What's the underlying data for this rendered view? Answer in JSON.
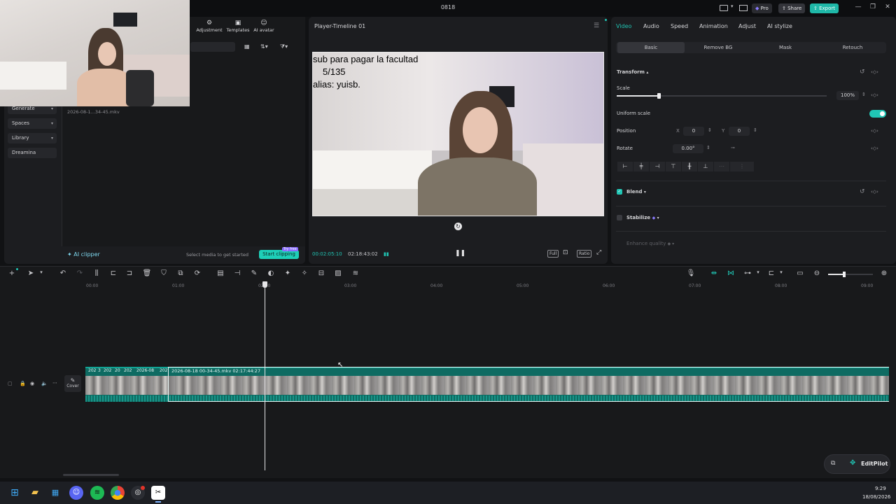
{
  "window": {
    "title": "0818",
    "pro_label": "Pro",
    "share_label": "Share",
    "export_label": "Export"
  },
  "media_toolbar": {
    "adjustment": "Adjustment",
    "templates": "Templates",
    "ai_avatar": "AI avatar"
  },
  "left_nav": {
    "items": [
      "Generate",
      "Spaces",
      "Library",
      "Dreamina"
    ]
  },
  "media": {
    "file_name": "2026-08-1...34-45.mkv",
    "ai_clipper": "AI clipper",
    "hint": "Select media to get started",
    "start_clipping": "Start clipping",
    "try_free": "Try free"
  },
  "player": {
    "title": "Player-Timeline 01",
    "current_time": "00:02:05:10",
    "total_time": "02:18:43:02",
    "overlay_lines": [
      "sub para pagar la facultad",
      "5/135",
      "alias: yuisb."
    ],
    "full_label": "Full",
    "ratio_label": "Ratio"
  },
  "props": {
    "tabs": [
      "Video",
      "Audio",
      "Speed",
      "Animation",
      "Adjust",
      "AI stylize"
    ],
    "active_tab": "Video",
    "subtabs": [
      "Basic",
      "Remove BG",
      "Mask",
      "Retouch"
    ],
    "transform_label": "Transform",
    "scale_label": "Scale",
    "scale_value": "100%",
    "scale_fraction": 0.2,
    "uniform_scale_label": "Uniform scale",
    "position_label": "Position",
    "pos_x_label": "X",
    "pos_x": "0",
    "pos_y_label": "Y",
    "pos_y": "0",
    "rotate_label": "Rotate",
    "rotate_value": "0.00°",
    "blend_label": "Blend",
    "stabilize_label": "Stabilize",
    "enhance_label": "Enhance quality",
    "accent": "#20c5b4"
  },
  "timeline": {
    "ruler": [
      "00:00",
      "01:00",
      "02:00",
      "03:00",
      "04:00",
      "05:00",
      "06:00",
      "07:00",
      "08:00",
      "09:00"
    ],
    "clip_label": "2026-08-18 00-34-45.mkv  02:17:44:27",
    "small_clips": [
      "202",
      "3",
      "202",
      "20",
      "202",
      "2026-08",
      "202"
    ],
    "cover_label": "Cover",
    "editpilot_label": "EditPilot"
  },
  "taskbar": {
    "time": "9:29",
    "date": "18/08/2026"
  }
}
